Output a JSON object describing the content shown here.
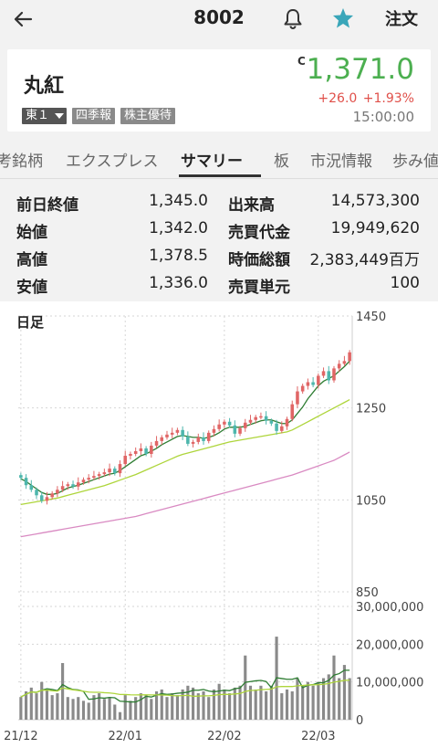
{
  "header": {
    "back_icon": "arrow-left-icon",
    "code": "8002",
    "bell_icon": "bell-icon",
    "star_icon": "star-icon",
    "star_color": "#3aa6b9",
    "order_label": "注文"
  },
  "stock": {
    "name": "丸紅",
    "market": "東１",
    "tags": [
      "四季報",
      "株主優待"
    ],
    "c_mark": "C",
    "price": "1,371.0",
    "change": "+26.0",
    "change_pct": "+1.93%",
    "time": "15:00:00",
    "up_color": "#4caf50",
    "change_color": "#e0504a"
  },
  "tabs": [
    "考銘柄",
    "エクスプレス",
    "サマリー",
    "板",
    "市況情報",
    "歩み値"
  ],
  "active_tab": "サマリー",
  "stats": [
    {
      "label": "前日終値",
      "value": "1,345.0"
    },
    {
      "label": "出来高",
      "value": "14,573,300"
    },
    {
      "label": "始値",
      "value": "1,342.0"
    },
    {
      "label": "売買代金",
      "value": "19,949,620"
    },
    {
      "label": "高値",
      "value": "1,378.5"
    },
    {
      "label": "時価総額",
      "value": "2,383,449百万"
    },
    {
      "label": "安値",
      "value": "1,336.0"
    },
    {
      "label": "売買単元",
      "value": "100"
    }
  ],
  "chart_title": "日足",
  "chart_data": {
    "type": "candlestick",
    "price_axis": {
      "ticks": [
        "1450",
        "1250",
        "1050",
        "850"
      ],
      "values": [
        1450,
        1250,
        1050,
        850
      ],
      "ylim": [
        850,
        1450
      ]
    },
    "volume_axis": {
      "ticks": [
        "30,000,000",
        "20,000,000",
        "10,000,000",
        "0"
      ],
      "values": [
        30000000,
        20000000,
        10000000,
        0
      ],
      "ylim": [
        0,
        30000000
      ]
    },
    "x_ticks": [
      "21/12",
      "22/01",
      "22/02",
      "22/03"
    ],
    "x_tick_index": [
      0,
      20,
      39,
      57
    ],
    "up_color": "#e06666",
    "down_color": "#4db6ac",
    "ma_colors": [
      "#2e7d32",
      "#aed53b",
      "#d98ac2"
    ],
    "close": [
      1098,
      1082,
      1072,
      1060,
      1048,
      1056,
      1064,
      1072,
      1080,
      1084,
      1079,
      1088,
      1094,
      1098,
      1102,
      1106,
      1110,
      1118,
      1108,
      1128,
      1146,
      1150,
      1156,
      1162,
      1150,
      1168,
      1178,
      1186,
      1192,
      1196,
      1202,
      1188,
      1172,
      1176,
      1186,
      1178,
      1196,
      1204,
      1214,
      1220,
      1212,
      1194,
      1206,
      1218,
      1224,
      1230,
      1232,
      1222,
      1216,
      1200,
      1210,
      1226,
      1258,
      1286,
      1298,
      1306,
      1300,
      1320,
      1330,
      1310,
      1336,
      1346,
      1352,
      1371
    ],
    "ma_short": [
      1096,
      1090,
      1082,
      1074,
      1066,
      1062,
      1062,
      1064,
      1070,
      1076,
      1079,
      1082,
      1086,
      1090,
      1094,
      1098,
      1102,
      1106,
      1108,
      1114,
      1122,
      1130,
      1138,
      1146,
      1150,
      1156,
      1162,
      1170,
      1176,
      1182,
      1188,
      1190,
      1188,
      1186,
      1186,
      1184,
      1186,
      1190,
      1196,
      1204,
      1208,
      1208,
      1208,
      1210,
      1214,
      1218,
      1222,
      1224,
      1224,
      1220,
      1216,
      1216,
      1224,
      1238,
      1252,
      1270,
      1284,
      1298,
      1308,
      1314,
      1320,
      1330,
      1340,
      1352
    ],
    "ma_mid": [
      1040,
      1042,
      1044,
      1046,
      1048,
      1050,
      1052,
      1054,
      1057,
      1060,
      1063,
      1066,
      1069,
      1072,
      1075,
      1078,
      1081,
      1085,
      1089,
      1093,
      1097,
      1101,
      1105,
      1110,
      1115,
      1120,
      1125,
      1130,
      1135,
      1140,
      1145,
      1149,
      1152,
      1155,
      1158,
      1161,
      1164,
      1167,
      1170,
      1173,
      1176,
      1178,
      1180,
      1182,
      1184,
      1186,
      1188,
      1190,
      1192,
      1194,
      1196,
      1198,
      1202,
      1208,
      1214,
      1220,
      1226,
      1232,
      1238,
      1244,
      1250,
      1256,
      1262,
      1268
    ],
    "ma_long": [
      970,
      972,
      974,
      976,
      978,
      980,
      982,
      984,
      986,
      988,
      990,
      992,
      994,
      996,
      998,
      1000,
      1002,
      1004,
      1006,
      1008,
      1010,
      1012,
      1014,
      1017,
      1020,
      1023,
      1026,
      1029,
      1032,
      1035,
      1038,
      1041,
      1044,
      1047,
      1050,
      1053,
      1056,
      1059,
      1062,
      1065,
      1068,
      1071,
      1074,
      1077,
      1080,
      1083,
      1086,
      1089,
      1092,
      1095,
      1098,
      1101,
      1104,
      1108,
      1112,
      1116,
      1120,
      1124,
      1128,
      1132,
      1136,
      1142,
      1148,
      1154
    ],
    "volume": [
      6000000,
      7500000,
      8500000,
      7000000,
      10000000,
      8000000,
      6500000,
      7000000,
      15000000,
      6000000,
      5500000,
      6000000,
      5000000,
      4500000,
      6500000,
      7000000,
      5500000,
      6000000,
      4000000,
      2000000,
      6500000,
      5000000,
      6000000,
      7000000,
      6500000,
      5500000,
      7500000,
      8000000,
      6000000,
      7000000,
      6500000,
      8000000,
      9000000,
      8500000,
      7000000,
      7500000,
      6000000,
      8000000,
      9500000,
      8000000,
      7000000,
      8500000,
      9000000,
      17000000,
      9000000,
      8000000,
      9000000,
      7500000,
      9000000,
      22000000,
      7000000,
      8000000,
      7500000,
      11000000,
      9000000,
      10000000,
      9000000,
      10000000,
      11000000,
      12000000,
      17000000,
      11000000,
      14500000,
      11000000
    ]
  }
}
